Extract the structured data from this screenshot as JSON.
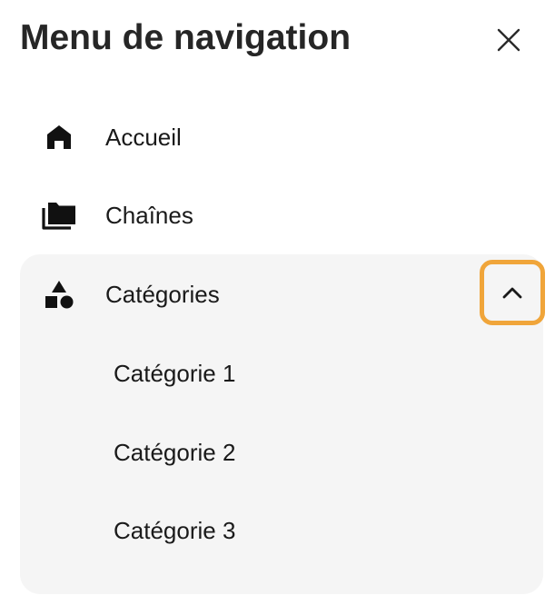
{
  "header": {
    "title": "Menu de navigation",
    "close_icon": "close-icon"
  },
  "nav": {
    "items": [
      {
        "label": "Accueil",
        "icon": "home-icon"
      },
      {
        "label": "Chaînes",
        "icon": "folders-icon"
      }
    ],
    "group": {
      "label": "Catégories",
      "icon": "shapes-icon",
      "expanded": true,
      "toggle_icon": "chevron-up-icon",
      "highlight_color": "#f0a53a",
      "background_color": "#f5f5f5",
      "sub_items": [
        {
          "label": "Catégorie 1"
        },
        {
          "label": "Catégorie 2"
        },
        {
          "label": "Catégorie 3"
        }
      ]
    }
  }
}
